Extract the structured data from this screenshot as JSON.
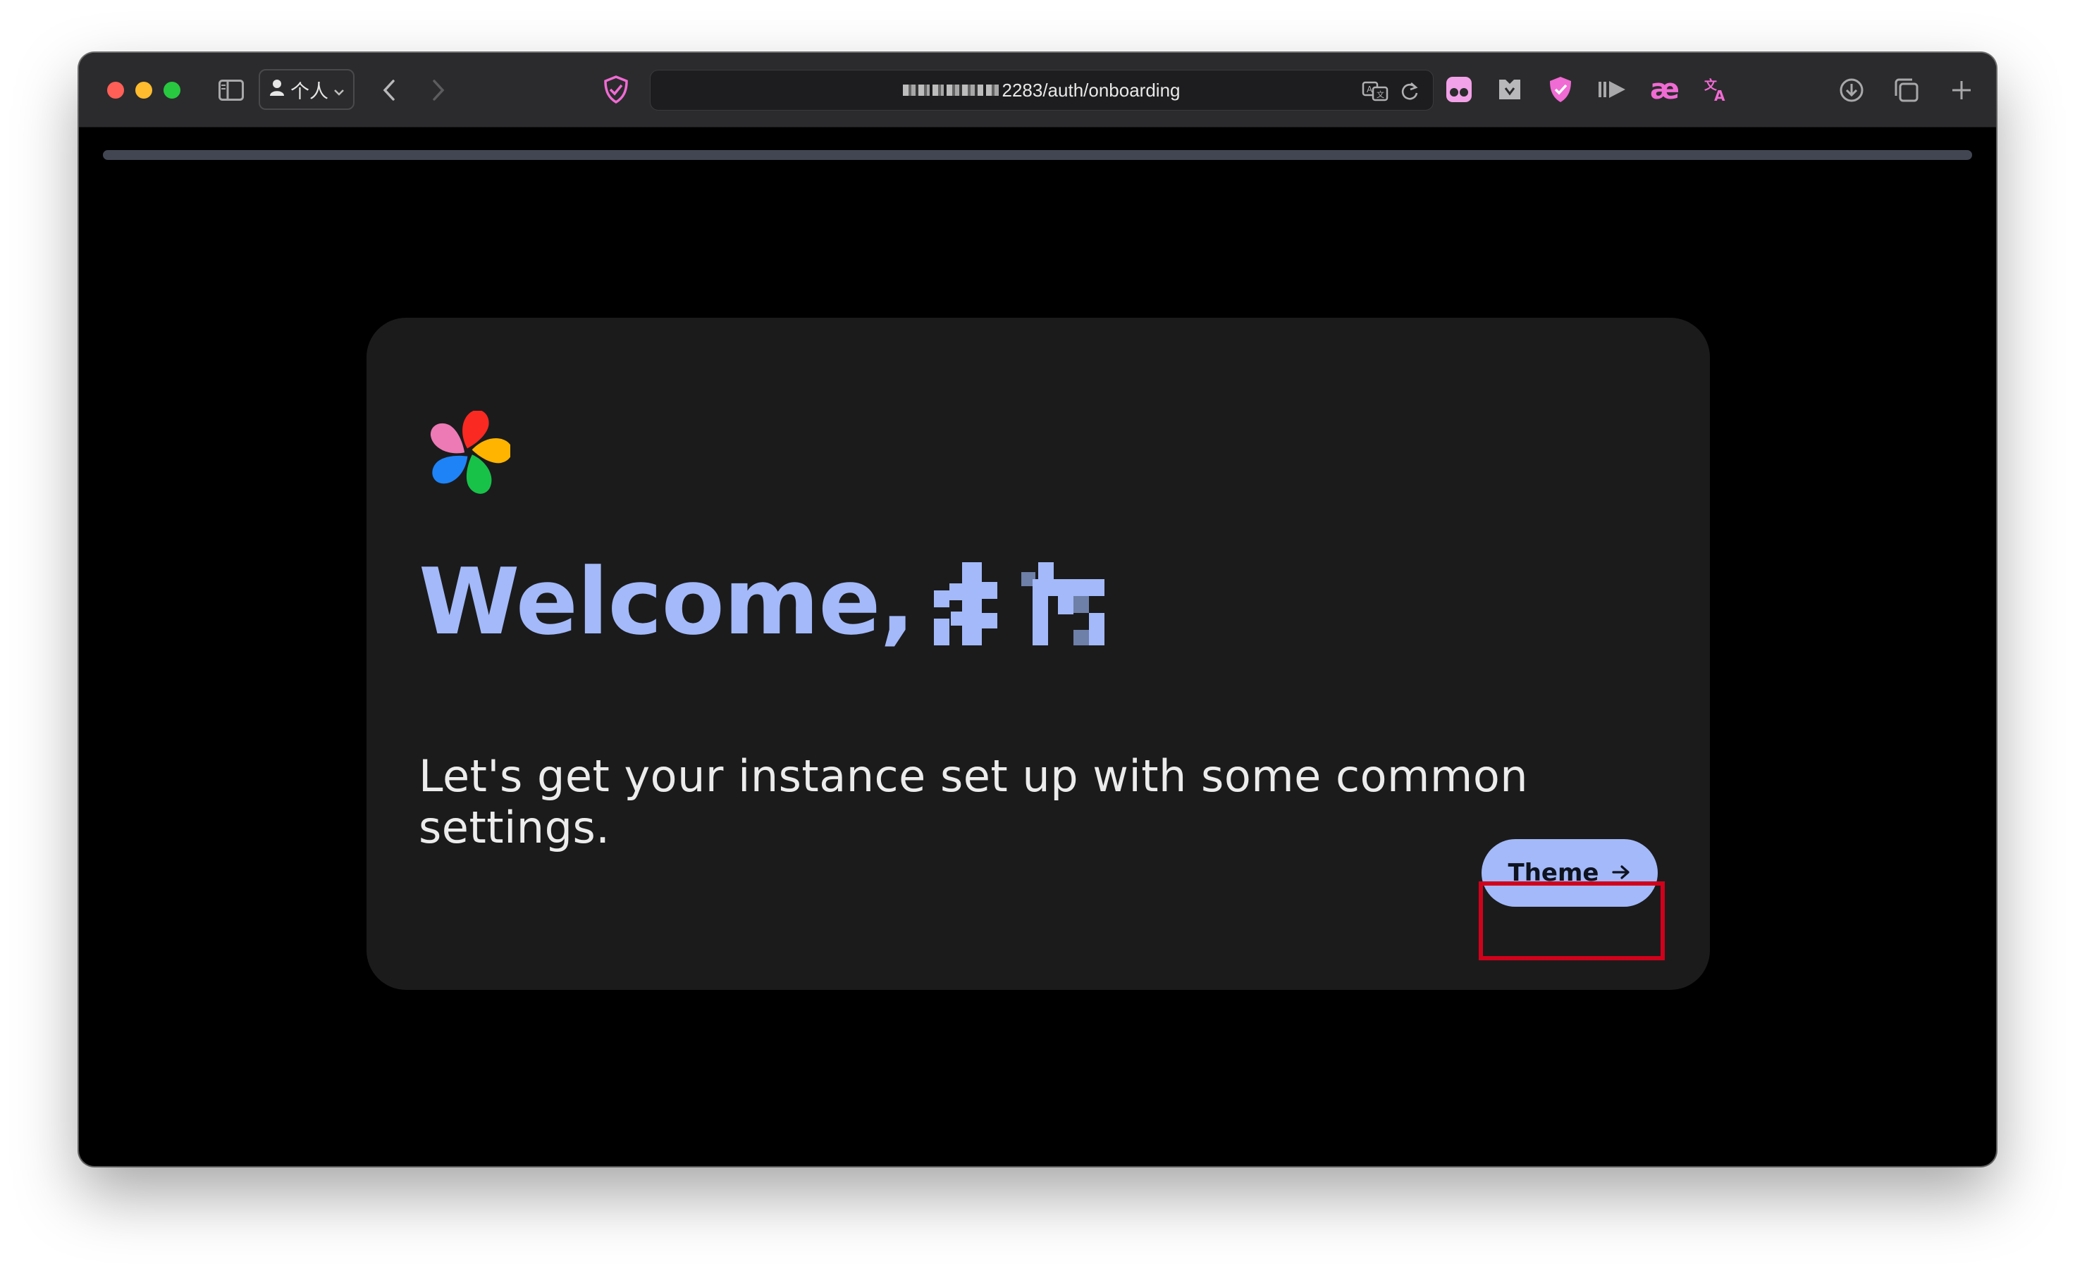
{
  "browser": {
    "profile_label": "个人",
    "url_suffix": "2283/auth/onboarding",
    "icons": [
      "sidebar-icon",
      "person-icon",
      "chevron-down-icon",
      "back-icon",
      "forward-icon",
      "shield-check-icon",
      "translate-icon",
      "reload-icon",
      "extension-glasses-icon",
      "extension-bucket-icon",
      "extension-shield-icon",
      "extension-play-icon",
      "extension-ae-icon",
      "extension-translate-icon",
      "download-icon",
      "tabs-icon",
      "new-tab-icon"
    ]
  },
  "onboarding": {
    "progress_percent": 100,
    "welcome_prefix": "Welcome,",
    "subtitle": "Let's get your instance set up with some common settings.",
    "next_button_label": "Theme"
  },
  "colors": {
    "accent": "#a3b9f9",
    "card_bg": "#1b1b1c",
    "page_bg": "#000000",
    "highlight": "#d0021b"
  }
}
